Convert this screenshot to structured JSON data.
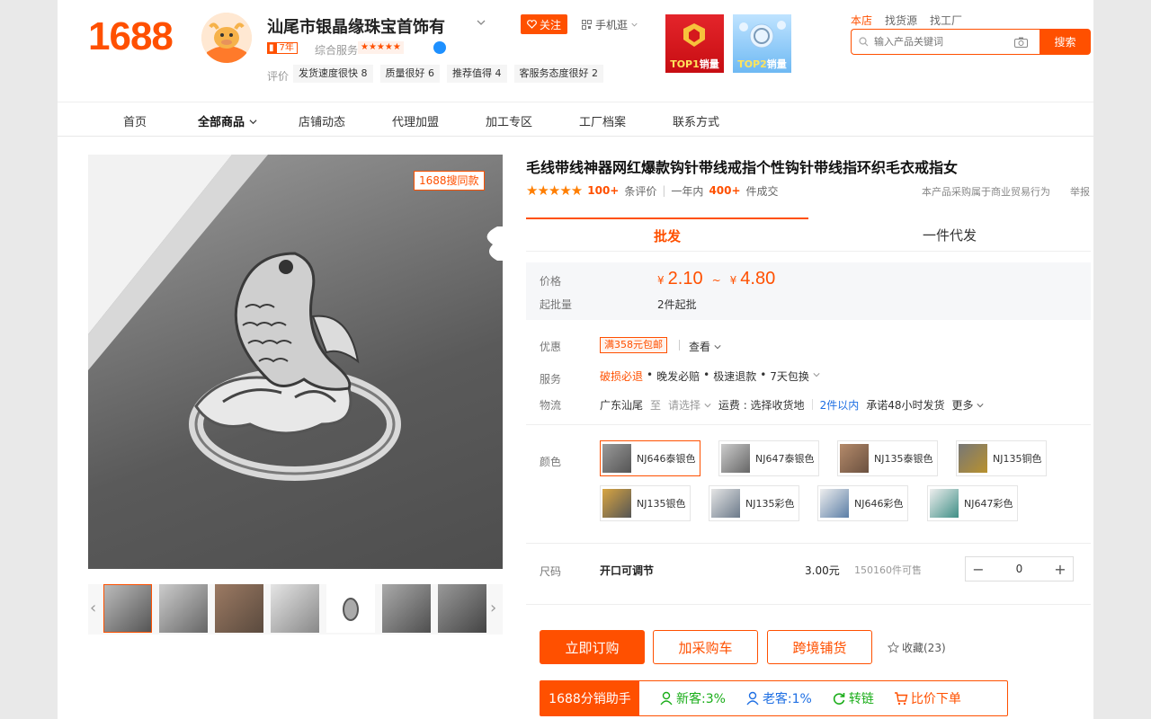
{
  "header": {
    "logo": "1688",
    "shop_name": "汕尾市银晶缘珠宝首饰有",
    "follow_label": "关注",
    "mobile_label": "手机逛",
    "years_num": "7",
    "years_suffix": "年",
    "service_label": "综合服务",
    "service_stars": "★★★★★",
    "eval_label": "评价",
    "evaluations": [
      {
        "name": "发货速度很快",
        "score": "8"
      },
      {
        "name": "质量很好",
        "score": "6"
      },
      {
        "name": "推荐值得",
        "score": "4"
      },
      {
        "name": "客服务态度很好",
        "score": "2"
      }
    ],
    "badges": [
      {
        "rank": "TOP1",
        "text": "销量"
      },
      {
        "rank": "TOP2",
        "text": "销量"
      }
    ],
    "scope_links": [
      "本店",
      "找货源",
      "找工厂"
    ],
    "search_placeholder": "输入产品关键词",
    "search_button": "搜索"
  },
  "nav": {
    "items": [
      "首页",
      "全部商品",
      "店铺动态",
      "代理加盟",
      "加工专区",
      "工厂档案",
      "联系方式"
    ]
  },
  "gallery": {
    "same_style_tag": "1688搜同款"
  },
  "product": {
    "title": "毛线带线神器网红爆款钩针带线戒指个性钩针带线指环织毛衣戒指女",
    "stars": "★★★★★",
    "reviews_count": "100+",
    "reviews_label": "条评价",
    "sales_prefix": "一年内",
    "sales_count": "400+",
    "sales_label": "件成交",
    "trade_note": "本产品采购属于商业贸易行为",
    "report": "举报",
    "tabs": [
      "批发",
      "一件代发"
    ],
    "price_label": "价格",
    "currency": "¥",
    "price_low": "2.10",
    "price_sep": "~",
    "price_high": "4.80",
    "moq_label": "起批量",
    "moq": "2件起批",
    "promo_label": "优惠",
    "promo_tag": "满358元包邮",
    "promo_look": "查看",
    "service_label": "服务",
    "service_items": [
      "破损必退",
      "晚发必赔",
      "极速退款",
      "7天包换"
    ],
    "logistics_label": "物流",
    "logistics_from": "广东汕尾",
    "logistics_to": "至",
    "logistics_select": "请选择",
    "logistics_fee": "运费 : 选择收货地",
    "logistics_qty": "2件以内",
    "logistics_promise": "承诺48小时发货",
    "logistics_more": "更多",
    "color_label": "颜色",
    "colors": [
      "NJ646泰银色",
      "NJ647泰银色",
      "NJ135泰银色",
      "NJ135铜色",
      "NJ135银色",
      "NJ135彩色",
      "NJ646彩色",
      "NJ647彩色"
    ],
    "size_label": "尺码",
    "size_name": "开口可调节",
    "size_price": "3.00元",
    "size_stock": "150160件可售",
    "quantity": "0",
    "buttons": {
      "order": "立即订购",
      "cart": "加采购车",
      "cross_border": "跨境铺货",
      "favorite": "收藏(23)"
    },
    "assistant": {
      "title": "1688分销助手",
      "new_cust": "新客:3%",
      "old_cust": "老客:1%",
      "relink": "转链",
      "compare": "比价下单"
    }
  },
  "colors": {
    "accent": "#ff5000",
    "blue": "#1e6fe3"
  }
}
